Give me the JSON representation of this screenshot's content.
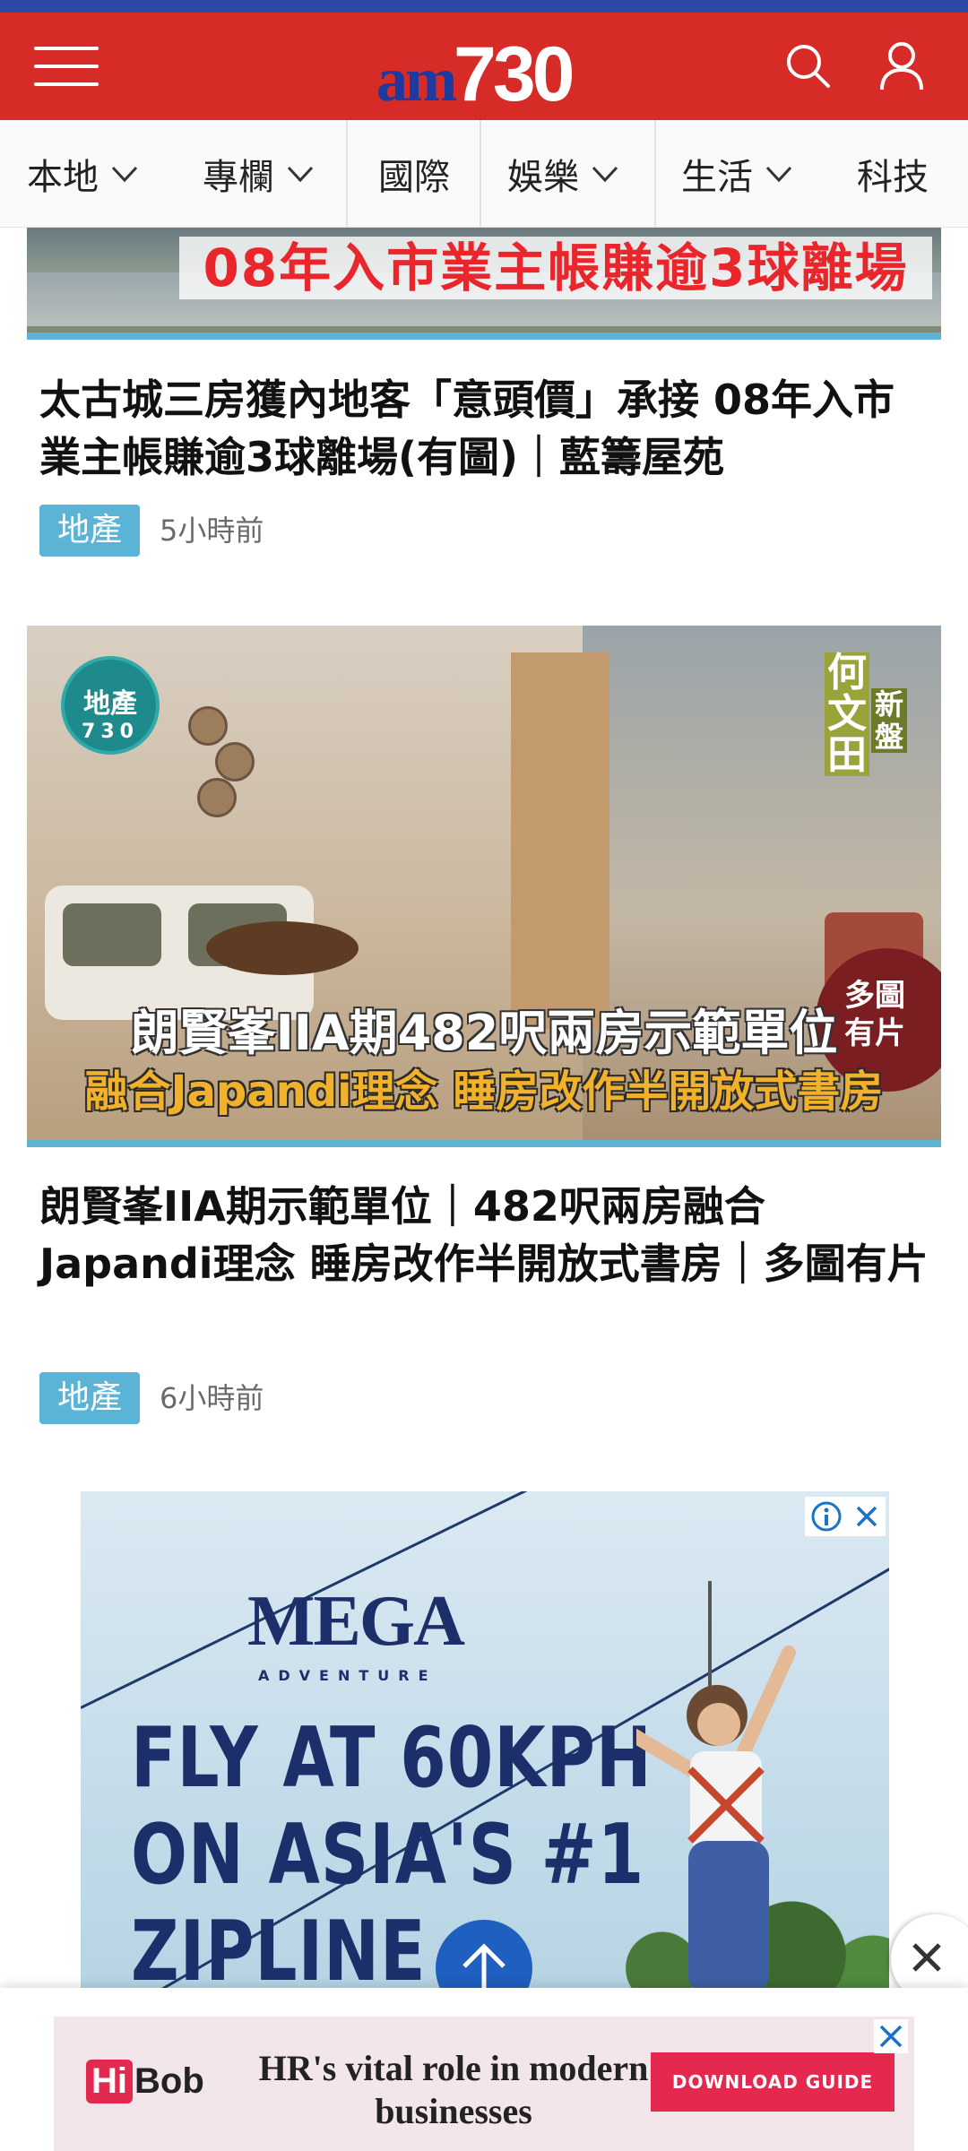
{
  "header": {
    "logo_am": "am",
    "logo_num": "730",
    "colors": {
      "brand_red": "#d62b27",
      "brand_blue": "#1d3aa0"
    }
  },
  "nav": {
    "items": [
      {
        "label": "本地",
        "has_dropdown": true
      },
      {
        "label": "專欄",
        "has_dropdown": true
      },
      {
        "label": "國際",
        "has_dropdown": false
      },
      {
        "label": "娛樂",
        "has_dropdown": true
      },
      {
        "label": "生活",
        "has_dropdown": true
      },
      {
        "label": "科技",
        "has_dropdown": false
      }
    ]
  },
  "articles": [
    {
      "banner_text": "08年入市業主帳賺逾3球離場",
      "title": "太古城三房獲內地客「意頭價」承接 08年入市業主帳賺逾3球離場(有圖)｜藍籌屋苑",
      "tag": "地產",
      "time": "5小時前"
    },
    {
      "photo_badge_top": "地產",
      "photo_badge_bottom": "730",
      "corner_tag_main": "何文田",
      "corner_tag_sub": "新盤",
      "more_badge": "多圖有片",
      "photo_line1": "朗賢峯IIA期482呎兩房示範單位",
      "photo_line2": "融合Japandi理念 睡房改作半開放式書房",
      "title": "朗賢峯IIA期示範單位｜482呎兩房融合Japandi理念 睡房改作半開放式書房｜多圖有片",
      "tag": "地產",
      "time": "6小時前"
    }
  ],
  "ad": {
    "logo": "MEGA",
    "logo_sub": "ADVENTURE",
    "lines": [
      "FLY AT 60KPH",
      "ON ASIA'S #1",
      "ZIPLINE"
    ]
  },
  "bottom_ad": {
    "brand_hi": "Hi",
    "brand_bob": "Bob",
    "headline": "HR's vital role in modern businesses",
    "button": "DOWNLOAD GUIDE"
  }
}
